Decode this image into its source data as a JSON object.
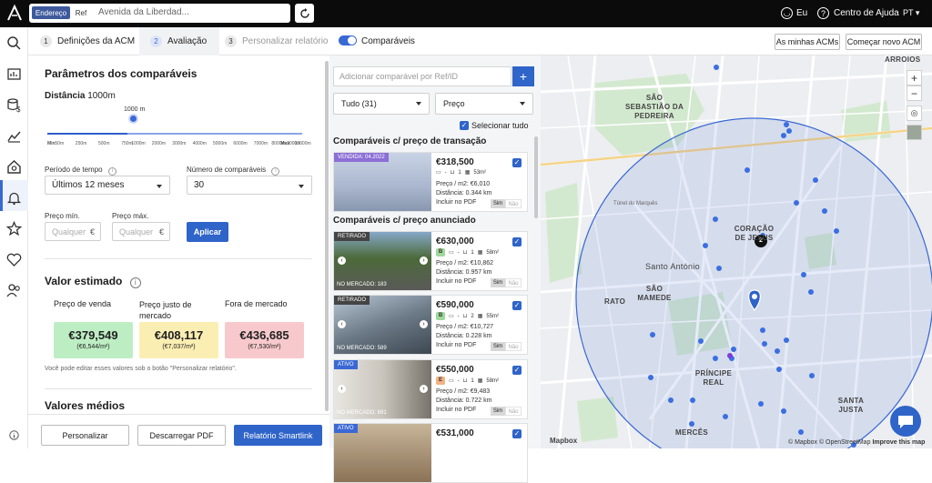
{
  "topbar": {
    "search_mode_address": "Endereço",
    "search_mode_ref": "Ref",
    "search_value": "Avenida da Liberdad...",
    "user_label": "Eu",
    "help_label": "Centro de Ajuda",
    "language": "PT"
  },
  "tabs": [
    {
      "num": "1",
      "label": "Definições da ACM"
    },
    {
      "num": "2",
      "label": "Avaliação"
    },
    {
      "num": "3",
      "label": "Personalizar relatório"
    }
  ],
  "toggle_label": "Comparáveis",
  "header_buttons": {
    "my_acms": "As minhas ACMs",
    "start_new": "Começar novo ACM"
  },
  "params": {
    "title": "Parâmetros dos comparáveis",
    "distance_label": "Distância",
    "distance_value": "1000m",
    "slider_value": "1000 m",
    "slider_fraction": 0.3,
    "ticks": [
      "Min",
      "50m",
      "250m",
      "500m",
      "750m",
      "1000m",
      "2000m",
      "3000m",
      "4000m",
      "5000m",
      "6000m",
      "7000m",
      "8000m",
      "9000m",
      "Max",
      "10000m"
    ],
    "period_label": "Período de tempo",
    "period_value": "Últimos 12 meses",
    "count_label": "Número de comparáveis",
    "count_value": "30",
    "min_price_label": "Preço mín.",
    "max_price_label": "Preço máx.",
    "price_placeholder": "Qualquer",
    "currency": "€",
    "apply_label": "Aplicar"
  },
  "estimate": {
    "title": "Valor estimado",
    "cards": [
      {
        "head": "Preço de venda",
        "value": "€379,549",
        "sub": "(€6,544/m²)",
        "bg": "#bdeec3"
      },
      {
        "head": "Preço justo de mercado",
        "value": "€408,117",
        "sub": "(€7,037/m²)",
        "bg": "#fbeeb2"
      },
      {
        "head": "Fora de mercado",
        "value": "€436,685",
        "sub": "(€7,530/m²)",
        "bg": "#f8c9cc"
      }
    ],
    "note": "Você pode editar esses valores sob o botão \"Personalizar relatório\".",
    "averages_title": "Valores médios"
  },
  "footer": {
    "customize": "Personalizar",
    "download": "Descarregar PDF",
    "smartlink": "Relatório Smartlink"
  },
  "comparables": {
    "add_placeholder": "Adicionar comparável por Ref/ID",
    "plus": "+",
    "filter_all": "Tudo (31)",
    "sort": "Preço",
    "select_all": "Selecionar tudo",
    "section_transaction": "Comparáveis c/ preço de transação",
    "section_listed": "Comparáveis c/ preço anunciado",
    "cards": [
      {
        "tag": "VENDIDA: 04.2022",
        "tag_color": "#8b6fd6",
        "price": "€318,500",
        "energy": "",
        "energy_color": "",
        "beds": "-",
        "baths": "1",
        "area": "53m²",
        "ppm": "Preço / m2: €6,010",
        "dist": "Distância: 0.344 km",
        "foot": "",
        "pdf": "Incluir no PDF",
        "sim": "Sim",
        "nao": "Não"
      },
      {
        "tag": "RETIRADO",
        "tag_color": "#444444",
        "price": "€630,000",
        "energy": "B",
        "energy_color": "#9fd89b",
        "beds": "-",
        "baths": "1",
        "area": "58m²",
        "ppm": "Preço / m2: €10,862",
        "dist": "Distância: 0.957 km",
        "foot": "NO MERCADO: 183",
        "pdf": "Incluir no PDF",
        "sim": "Sim",
        "nao": "Não"
      },
      {
        "tag": "RETIRADO",
        "tag_color": "#444444",
        "price": "€590,000",
        "energy": "B",
        "energy_color": "#9fd89b",
        "beds": "-",
        "baths": "2",
        "area": "55m²",
        "ppm": "Preço / m2: €10,727",
        "dist": "Distância: 0.228 km",
        "foot": "NO MERCADO: 589",
        "pdf": "Incluir no PDF",
        "sim": "Sim",
        "nao": "Não"
      },
      {
        "tag": "ATIVO",
        "tag_color": "#3a68d4",
        "price": "€550,000",
        "energy": "E",
        "energy_color": "#f4b183",
        "beds": "-",
        "baths": "1",
        "area": "58m²",
        "ppm": "Preço / m2: €9,483",
        "dist": "Distância: 0.722 km",
        "foot": "NO MERCADO: 691",
        "pdf": "Incluir no PDF",
        "sim": "Sim",
        "nao": "Não"
      },
      {
        "tag": "ATIVO",
        "tag_color": "#3a68d4",
        "price": "€531,000",
        "energy": "",
        "energy_color": "",
        "beds": "",
        "baths": "",
        "area": "",
        "ppm": "",
        "dist": "",
        "foot": "",
        "pdf": "",
        "sim": "",
        "nao": ""
      }
    ]
  },
  "map": {
    "labels": {
      "arroios": "ARROIOS",
      "sao_sebastiao": "SÃO SEBASTIÃO DA PEDREIRA",
      "coracao": "CORAÇÃO DE JESUS",
      "santo_antonio": "Santo António",
      "sao_mamede": "SÃO MAMEDE",
      "rato": "RATO",
      "principe_real": "PRÍNCIPE REAL",
      "santa_justa": "SANTA JUSTA",
      "merces": "MERCÊS",
      "tunel": "Túnel do Marquês"
    },
    "cluster_count": "2",
    "attribution": "© Mapbox © OpenStreetMap",
    "improve": "Improve this map",
    "logo": "Mapbox"
  },
  "colors": {
    "accent": "#2f64c9",
    "topbar": "#0b0b0b"
  }
}
